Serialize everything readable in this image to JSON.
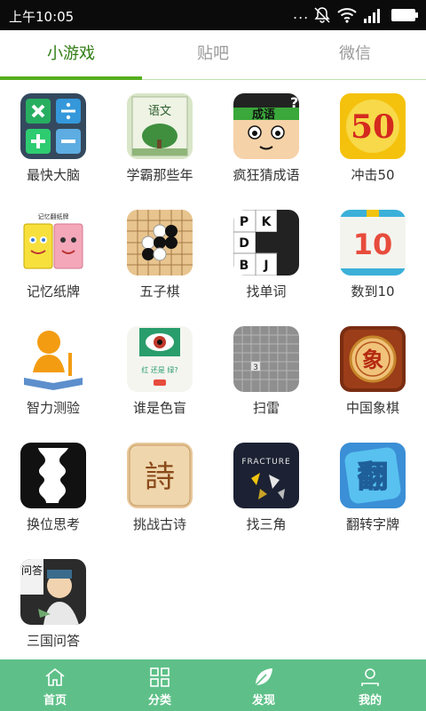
{
  "status_bar": {
    "time": "上午10:05",
    "dots": "..."
  },
  "tabs": [
    {
      "label": "小游戏",
      "active": true
    },
    {
      "label": "贴吧",
      "active": false
    },
    {
      "label": "微信",
      "active": false
    }
  ],
  "apps": [
    {
      "label": "最快大脑",
      "icon": "math-operators-icon"
    },
    {
      "label": "学霸那些年",
      "icon": "textbook-icon",
      "icon_text": "语文"
    },
    {
      "label": "疯狂猜成语",
      "icon": "idiom-face-icon",
      "icon_text": "成语"
    },
    {
      "label": "冲击50",
      "icon": "number-50-icon",
      "icon_text": "50"
    },
    {
      "label": "记忆纸牌",
      "icon": "memory-cards-icon",
      "icon_text": "记忆翻纸牌"
    },
    {
      "label": "五子棋",
      "icon": "gomoku-icon"
    },
    {
      "label": "找单词",
      "icon": "letter-grid-icon",
      "letters": [
        "P",
        "K",
        "D",
        "B",
        "J"
      ]
    },
    {
      "label": "数到10",
      "icon": "number-10-icon",
      "icon_text": "10"
    },
    {
      "label": "智力测验",
      "icon": "thinker-icon"
    },
    {
      "label": "谁是色盲",
      "icon": "eye-test-icon",
      "icon_text": "红 还是 绿?"
    },
    {
      "label": "扫雷",
      "icon": "minesweeper-icon",
      "icon_text": "3"
    },
    {
      "label": "中国象棋",
      "icon": "chinese-chess-icon",
      "icon_text": "象"
    },
    {
      "label": "换位思考",
      "icon": "vase-faces-icon"
    },
    {
      "label": "挑战古诗",
      "icon": "poem-icon",
      "icon_text": "詩"
    },
    {
      "label": "找三角",
      "icon": "fracture-icon",
      "icon_text": "FRACTURE"
    },
    {
      "label": "翻转字牌",
      "icon": "flip-char-icon",
      "icon_text": "翻"
    },
    {
      "label": "三国问答",
      "icon": "three-kingdoms-icon",
      "icon_text": "问答"
    }
  ],
  "bottom_nav": [
    {
      "label": "首页",
      "icon": "home-icon"
    },
    {
      "label": "分类",
      "icon": "grid-icon"
    },
    {
      "label": "发现",
      "icon": "leaf-icon"
    },
    {
      "label": "我的",
      "icon": "user-icon"
    }
  ],
  "colors": {
    "tab_active": "#2f7d12",
    "tab_indicator": "#54ae1d",
    "bottom_nav_bg": "#5ec088"
  }
}
